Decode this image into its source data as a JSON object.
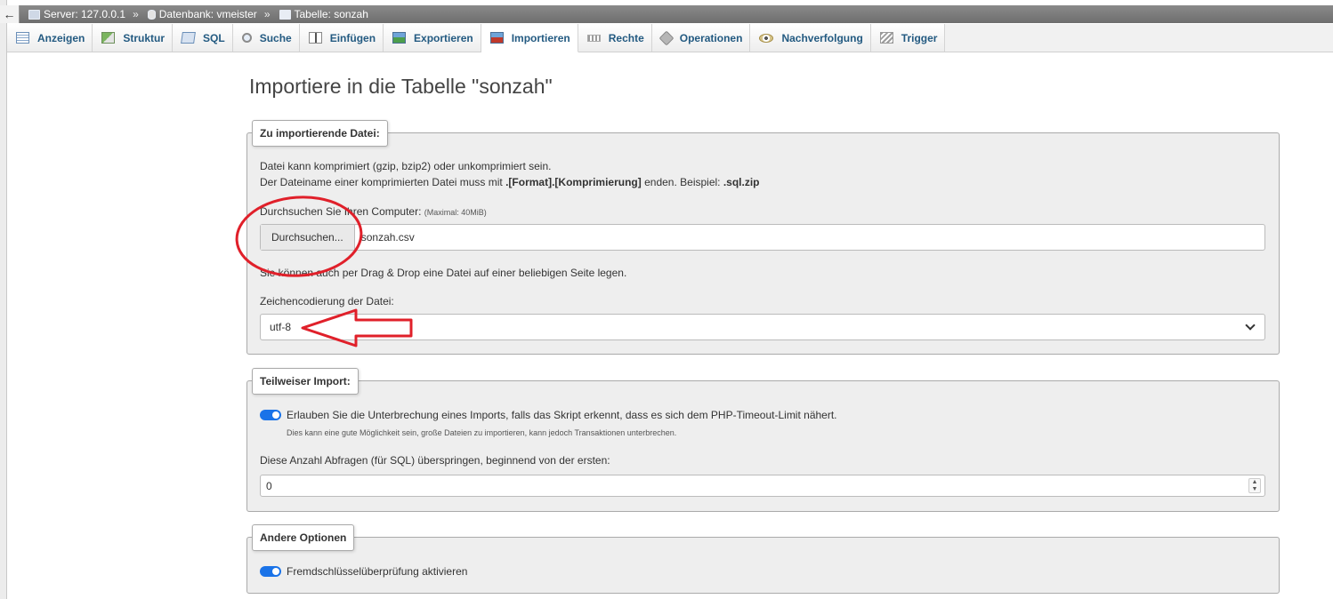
{
  "breadcrumb": {
    "back": "←",
    "server": "Server: 127.0.0.1",
    "database": "Datenbank: vmeister",
    "table": "Tabelle: sonzah",
    "separator": "»"
  },
  "tabs": [
    {
      "label": "Anzeigen",
      "icon": "browse-icon"
    },
    {
      "label": "Struktur",
      "icon": "structure-icon"
    },
    {
      "label": "SQL",
      "icon": "sql-icon"
    },
    {
      "label": "Suche",
      "icon": "search-icon"
    },
    {
      "label": "Einfügen",
      "icon": "insert-icon"
    },
    {
      "label": "Exportieren",
      "icon": "export-icon"
    },
    {
      "label": "Importieren",
      "icon": "import-icon",
      "active": true
    },
    {
      "label": "Rechte",
      "icon": "rights-icon"
    },
    {
      "label": "Operationen",
      "icon": "operations-icon"
    },
    {
      "label": "Nachverfolgung",
      "icon": "tracking-icon"
    },
    {
      "label": "Trigger",
      "icon": "trigger-icon"
    }
  ],
  "page_title": "Importiere in die Tabelle \"sonzah\"",
  "file_section": {
    "legend": "Zu importierende Datei:",
    "info_line1": "Datei kann komprimiert (gzip, bzip2) oder unkomprimiert sein.",
    "info_line2_pre": "Der Dateiname einer komprimierten Datei muss mit ",
    "info_line2_bold": ".[Format].[Komprimierung]",
    "info_line2_mid": " enden. Beispiel: ",
    "info_line2_example": ".sql.zip",
    "browse_label": "Durchsuchen Sie Ihren Computer:",
    "max_size": "(Maximal: 40MiB)",
    "browse_button": "Durchsuchen...",
    "selected_file": "sonzah.csv",
    "drag_drop_hint": "Sie können auch per Drag & Drop eine Datei auf einer beliebigen Seite legen.",
    "encoding_label": "Zeichencodierung der Datei:",
    "encoding_value": "utf-8"
  },
  "partial_section": {
    "legend": "Teilweiser Import:",
    "allow_interrupt": "Erlauben Sie die Unterbrechung eines Imports, falls das Skript erkennt, dass es sich dem PHP-Timeout-Limit nähert.",
    "allow_interrupt_hint": "Dies kann eine gute Möglichkeit sein, große Dateien zu importieren, kann jedoch Transaktionen unterbrechen.",
    "skip_label": "Diese Anzahl Abfragen (für SQL) überspringen, beginnend von der ersten:",
    "skip_value": "0"
  },
  "other_section": {
    "legend": "Andere Optionen",
    "fk_check": "Fremdschlüsselüberprüfung aktivieren"
  },
  "colors": {
    "link": "#235a81",
    "toggle": "#1a73e8",
    "annotation": "#e0202a"
  }
}
